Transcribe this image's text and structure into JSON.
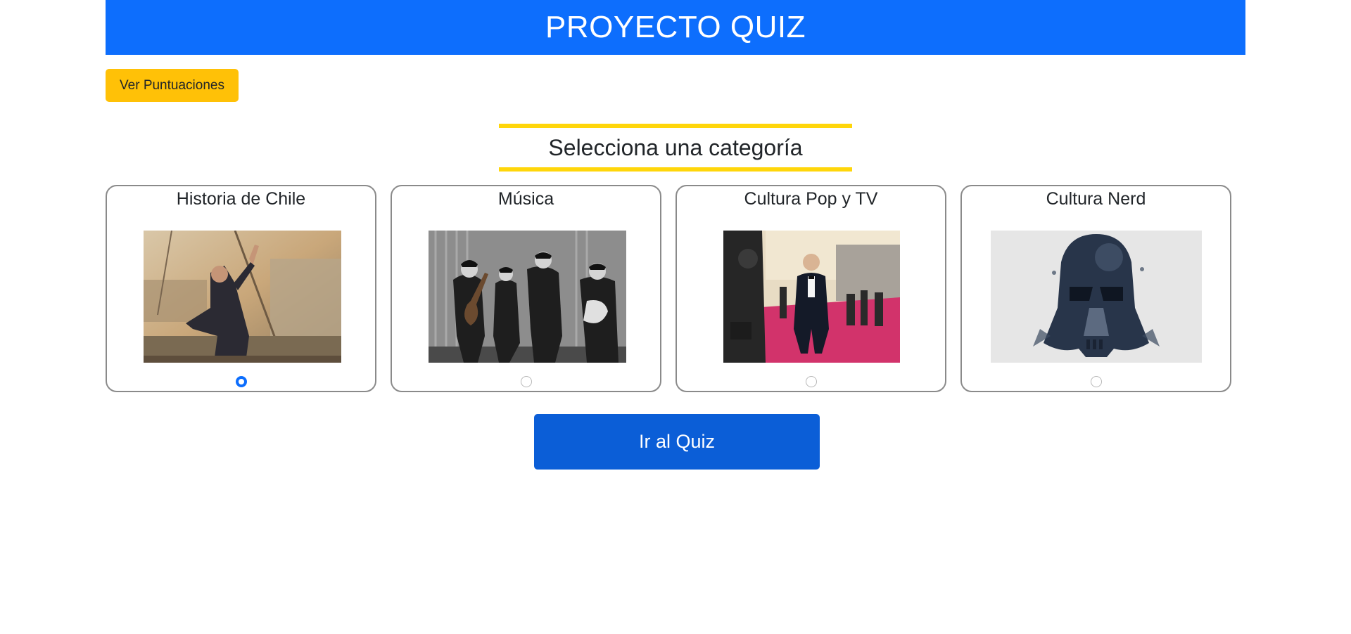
{
  "header": {
    "title": "PROYECTO QUIZ"
  },
  "scores_button": {
    "label": "Ver Puntuaciones"
  },
  "section": {
    "heading": "Selecciona una categoría"
  },
  "categories": [
    {
      "title": "Historia de Chile",
      "image": "naval-battle-painting",
      "selected": true
    },
    {
      "title": "Música",
      "image": "band-black-white-photo",
      "selected": false
    },
    {
      "title": "Cultura Pop y TV",
      "image": "red-carpet-photo",
      "selected": false
    },
    {
      "title": "Cultura Nerd",
      "image": "darth-vader-helmet-art",
      "selected": false
    }
  ],
  "quiz_button": {
    "label": "Ir al Quiz"
  },
  "colors": {
    "header": "#0d6efd",
    "scores_button": "#ffc107",
    "heading_rule": "#ffd60a",
    "quiz_button": "#0b5ed7"
  }
}
